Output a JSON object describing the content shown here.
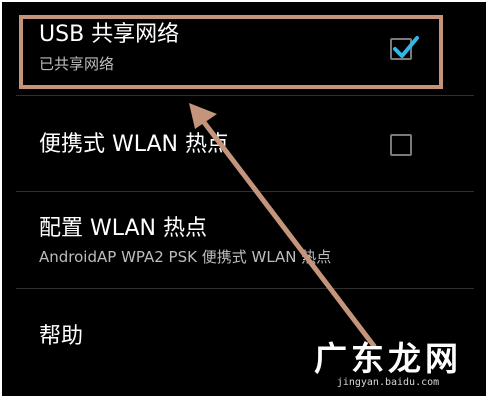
{
  "settings": {
    "items": [
      {
        "title": "USB 共享网络",
        "subtitle": "已共享网络",
        "checked": true
      },
      {
        "title": "便携式 WLAN 热点",
        "checked": false
      },
      {
        "title": "配置 WLAN 热点",
        "subtitle": "AndroidAP WPA2 PSK 便携式 WLAN 热点"
      },
      {
        "title": "帮助"
      }
    ]
  },
  "annotation": {
    "color": "#c4957b",
    "checkbox_accent": "#33b5e5"
  },
  "watermark": {
    "text": "广东龙网",
    "url": "jingyan.baidu.com"
  }
}
